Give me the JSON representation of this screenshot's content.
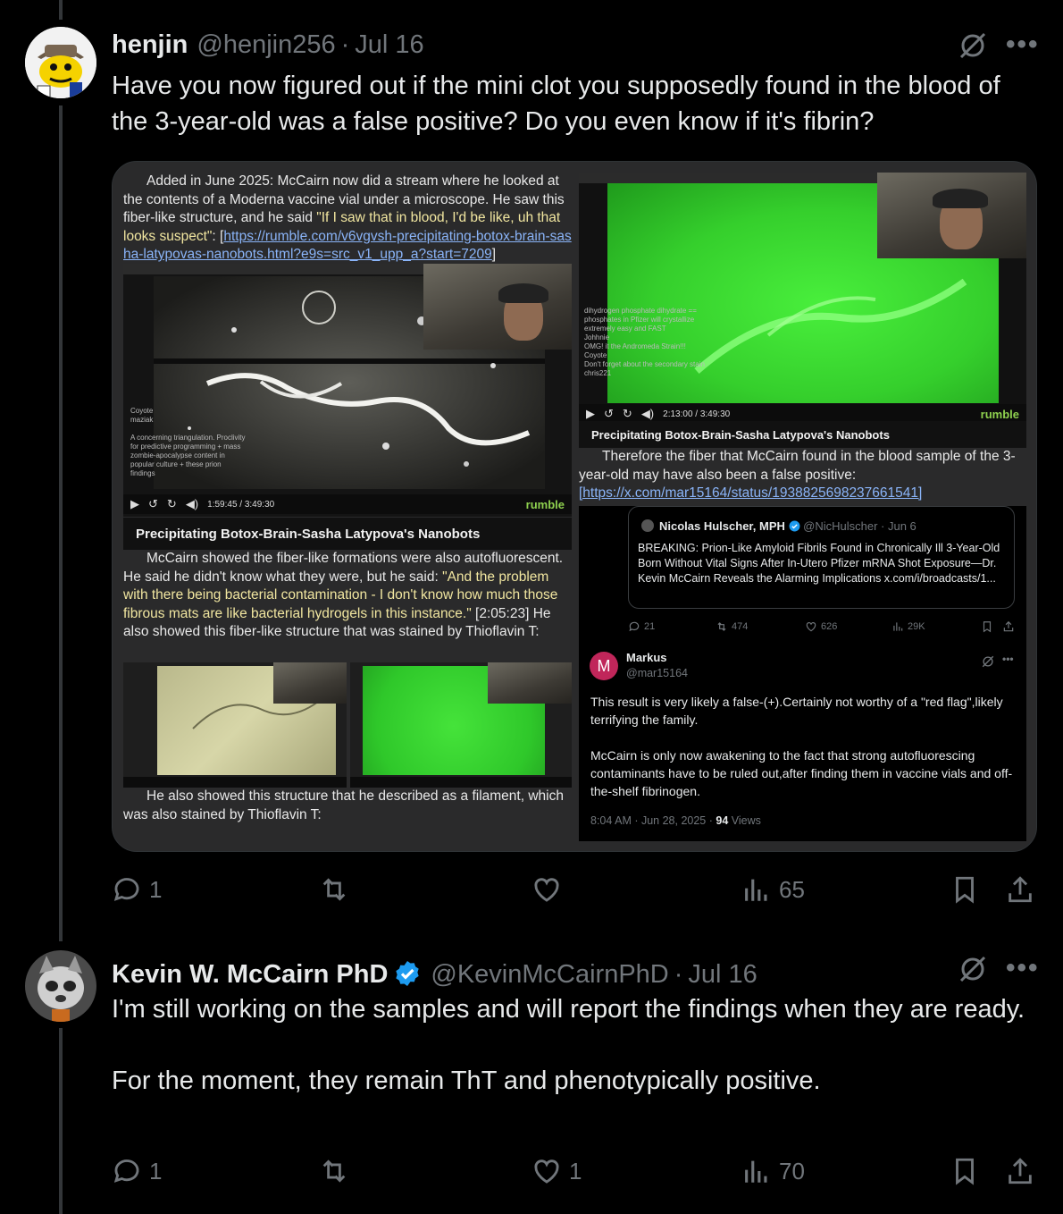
{
  "tweets": [
    {
      "name": "henjin",
      "handle": "@henjin256",
      "separator": "·",
      "date": "Jul 16",
      "text": "Have you now figured out if the mini clot you supposedly found in the blood of the 3-year-old was a false positive? Do you even know if it's fibrin?",
      "stats": {
        "replies": "1",
        "retweets": "",
        "likes": "",
        "views": "65"
      }
    },
    {
      "name": "Kevin W. McCairn PhD",
      "handle": "@KevinMcCairnPhD",
      "separator": "·",
      "date": "Jul 16",
      "verified": true,
      "text": "I'm still working on the samples and will report the findings when they are ready.\n\nFor the moment, they remain ThT and phenotypically positive.",
      "stats": {
        "replies": "1",
        "retweets": "",
        "likes": "1",
        "views": "70"
      }
    }
  ],
  "media": {
    "left": {
      "p1_a": "Added in June 2025: McCairn now did a stream where he looked at the contents of a Moderna vaccine vial under a microscope. He saw this fiber-like structure, and he said ",
      "p1_quote": "\"If I saw that in blood, I'd be like, uh that looks suspect\"",
      "p1_b": ": [",
      "p1_link": "https://rumble.com/v6vgvsh-precipitating-botox-brain-sasha-latypovas-nanobots.html?e9s=src_v1_upp_a?start=7209",
      "p1_c": "]",
      "video_caption": "Precipitating Botox-Brain-Sasha Latypova's Nanobots",
      "video_time": "1:59:45 / 3:49:30",
      "rumble": "rumble",
      "p2_a": "McCairn showed the fiber-like formations were also autofluorescent. He said he didn't know what they were, but he said: ",
      "p2_quote": "\"And the problem with there being bacterial contamination - I don't know how much those fibrous mats are like bacterial hydrogels in this instance.\"",
      "p2_b": " [2:05:23] He also showed this fiber-like structure that was stained by Thioflavin T:",
      "p3": "He also showed this structure that he described as a filament, which was also stained by Thioflavin T:"
    },
    "right": {
      "video_caption": "Precipitating Botox-Brain-Sasha Latypova's Nanobots",
      "video_time": "2:13:00 / 3:49:30",
      "rumble": "rumble",
      "p1": "Therefore the fiber that McCairn found in the blood sample of the 3-year-old may have also been a false positive:",
      "p1_link": "[https://x.com/mar15164/status/1938825698237661541]",
      "quote": {
        "name": "Nicolas Hulscher, MPH",
        "handle": "@NicHulscher · Jun 6",
        "text": "BREAKING: Prion-Like Amyloid Fibrils Found in Chronically Ill 3-Year-Old Born Without Vital Signs After In-Utero Pfizer mRNA Shot Exposure—Dr. Kevin McCairn Reveals the Alarming Implications x.com/i/broadcasts/1..."
      },
      "quote_stats": {
        "replies": "21",
        "retweets": "474",
        "likes": "626",
        "views": "29K"
      },
      "reply": {
        "avatar_letter": "M",
        "name": "Markus",
        "handle": "@mar15164",
        "text": "This result is very likely a false-(+).Certainly not worthy of a \"red flag\",likely terrifying the family.\n\nMcCairn is only now awakening to the fact that strong autofluorescing contaminants have to be ruled out,after finding them in vaccine vials and off-the-shelf fibrinogen.",
        "time": "8:04 AM · Jun 28, 2025 · ",
        "views_count": "94",
        "views_label": " Views"
      }
    }
  },
  "colors": {
    "background": "#000000",
    "text": "#e7e9ea",
    "muted": "#71767b",
    "verified": "#1d9bf0",
    "accent_green": "#5fd33a"
  }
}
